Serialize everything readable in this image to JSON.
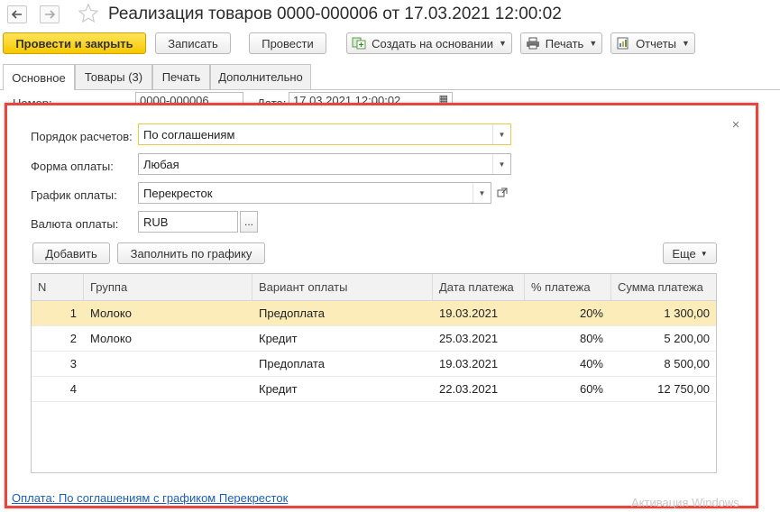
{
  "window": {
    "title": "Реализация товаров 0000-000006 от 17.03.2021 12:00:02"
  },
  "toolbar": {
    "post_close": "Провести и закрыть",
    "save": "Записать",
    "post": "Провести",
    "create_based": "Создать на основании",
    "print": "Печать",
    "reports": "Отчеты"
  },
  "tabs": [
    {
      "label": "Основное",
      "active": true
    },
    {
      "label": "Товары (3)",
      "active": false
    },
    {
      "label": "Печать",
      "active": false
    },
    {
      "label": "Дополнительно",
      "active": false
    }
  ],
  "background": {
    "number_label": "Номер:",
    "number_value": "0000-000006",
    "date_label": "Дата:",
    "date_value": "17.03.2021 12:00:02"
  },
  "dialog": {
    "settlement_order_label": "Порядок расчетов:",
    "settlement_order_value": "По соглашениям",
    "payment_form_label": "Форма оплаты:",
    "payment_form_value": "Любая",
    "payment_schedule_label": "График оплаты:",
    "payment_schedule_value": "Перекресток",
    "currency_label": "Валюта оплаты:",
    "currency_value": "RUB",
    "select_btn": "...",
    "add_btn": "Добавить",
    "fill_btn": "Заполнить по графику",
    "more_btn": "Еще",
    "close": "×"
  },
  "table": {
    "columns": [
      "N",
      "Группа",
      "Вариант оплаты",
      "Дата платежа",
      "% платежа",
      "Сумма платежа"
    ],
    "rows": [
      {
        "n": "1",
        "group": "Молоко",
        "variant": "Предоплата",
        "date": "19.03.2021",
        "percent": "20%",
        "sum": "1 300,00",
        "selected": true
      },
      {
        "n": "2",
        "group": "Молоко",
        "variant": "Кредит",
        "date": "25.03.2021",
        "percent": "80%",
        "sum": "5 200,00",
        "selected": false
      },
      {
        "n": "3",
        "group": "",
        "variant": "Предоплата",
        "date": "19.03.2021",
        "percent": "40%",
        "sum": "8 500,00",
        "selected": false
      },
      {
        "n": "4",
        "group": "",
        "variant": "Кредит",
        "date": "22.03.2021",
        "percent": "60%",
        "sum": "12 750,00",
        "selected": false
      }
    ]
  },
  "footer": {
    "link": "Оплата: По соглашениям с графиком Перекресток",
    "watermark": "Активация Windows"
  },
  "colors": {
    "primary_button": "#f6c800",
    "modal_border": "#e8453c",
    "selected_row": "#fbecb9",
    "link": "#1a5fb4"
  },
  "icons": [
    "back-arrow-icon",
    "forward-arrow-icon",
    "favorite-star-icon",
    "create-based-icon",
    "printer-icon",
    "reports-icon",
    "close-icon",
    "dropdown-arrow-icon",
    "open-link-icon",
    "calendar-icon"
  ]
}
